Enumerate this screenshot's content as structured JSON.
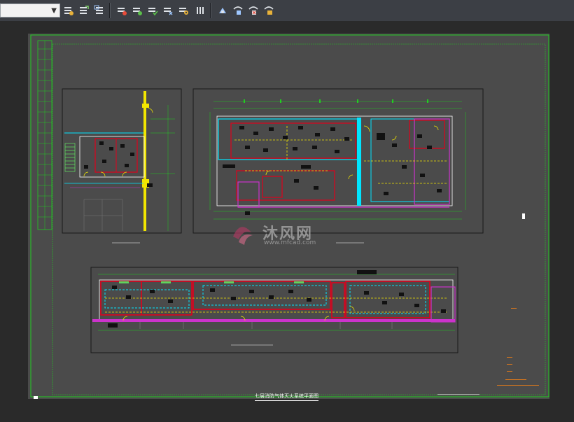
{
  "toolbar": {
    "layer_dropdown": {
      "value": ""
    },
    "groups": [
      {
        "icons": [
          "layer-properties-icon",
          "layer-state-icon",
          "layer-previous-icon"
        ]
      },
      {
        "icons": [
          "layer-isolate-icon",
          "layer-unisolate-icon",
          "layer-off-icon",
          "layer-freeze-icon",
          "layer-lock-icon",
          "layer-match-icon"
        ]
      },
      {
        "icons": [
          "layer-walk-icon",
          "layer-merge-icon",
          "layer-delete-icon",
          "layer-change-icon"
        ]
      }
    ]
  },
  "drawing": {
    "title": "七层消防气体灭火系统平面图",
    "watermark": {
      "cn": "沐风网",
      "url": "www.mfcad.com"
    }
  },
  "colors": {
    "frame": "#22cc22",
    "wall_red": "#e0001c",
    "pipe_cyan": "#00e5ff",
    "fixture_yellow": "#f2e600",
    "zone_magenta": "#cc33cc",
    "panel_border": "#1a1a1a",
    "background": "#4b4b4b"
  }
}
